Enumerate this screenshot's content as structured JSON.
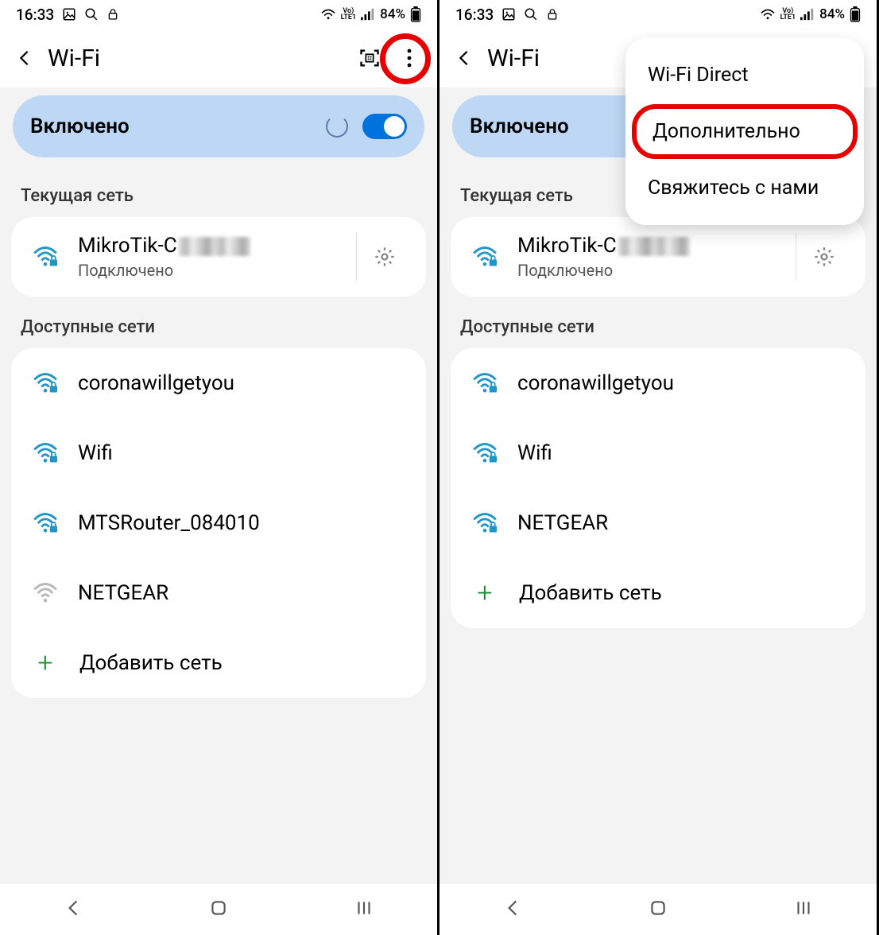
{
  "status": {
    "time": "16:33",
    "battery": "84%"
  },
  "header": {
    "title": "Wi-Fi"
  },
  "toggle": {
    "label": "Включено"
  },
  "sections": {
    "current": "Текущая сеть",
    "available": "Доступные сети"
  },
  "current_network": {
    "ssid_prefix": "MikroTik-C",
    "status": "Подключено"
  },
  "left_networks": [
    {
      "ssid": "coronawillgetyou",
      "secured": true
    },
    {
      "ssid": "Wifi",
      "secured": true
    },
    {
      "ssid": "MTSRouter_084010",
      "secured": true
    },
    {
      "ssid": "NETGEAR",
      "secured": false
    }
  ],
  "right_networks": [
    {
      "ssid": "coronawillgetyou",
      "secured": true
    },
    {
      "ssid": "Wifi",
      "secured": true
    },
    {
      "ssid": "NETGEAR",
      "secured": true
    }
  ],
  "add_network": "Добавить сеть",
  "menu": {
    "items": [
      {
        "label": "Wi-Fi Direct",
        "highlight": false
      },
      {
        "label": "Дополнительно",
        "highlight": true
      },
      {
        "label": "Свяжитесь с нами",
        "highlight": false
      }
    ]
  }
}
